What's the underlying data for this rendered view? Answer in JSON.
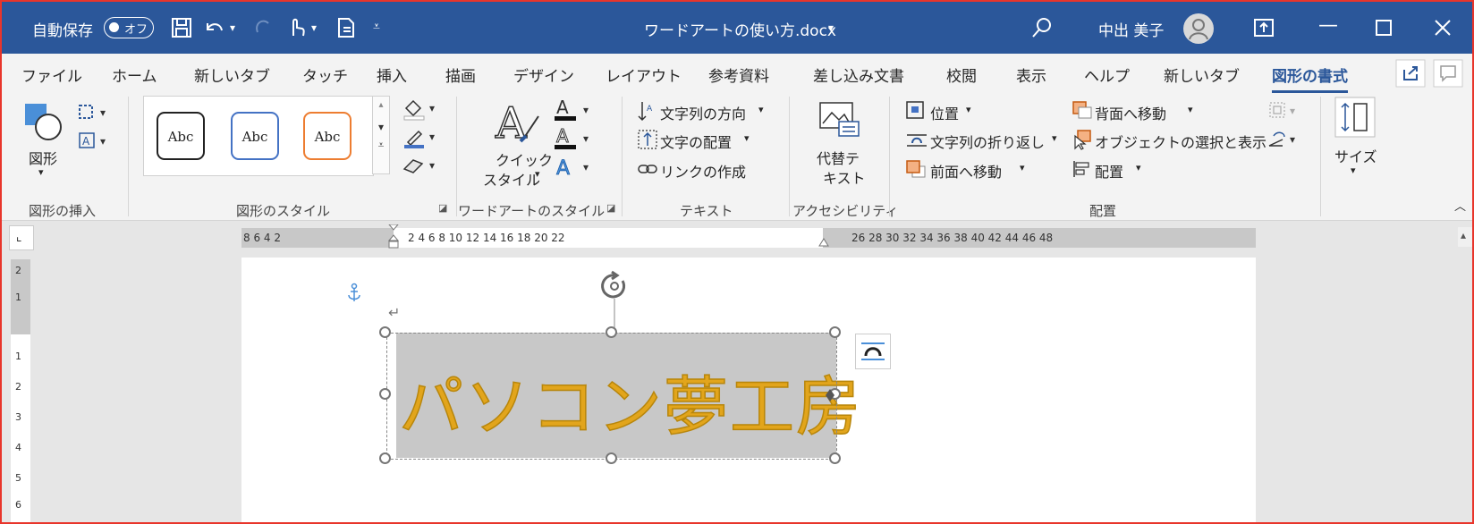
{
  "titlebar": {
    "autosave_label": "自動保存",
    "autosave_toggle": "オフ",
    "doc_title": "ワードアートの使い方.docx",
    "user_name": "中出 美子",
    "colors": {
      "bar": "#2b579a"
    }
  },
  "tabs": [
    "ファイル",
    "ホーム",
    "新しいタブ",
    "タッチ",
    "挿入",
    "描画",
    "デザイン",
    "レイアウト",
    "参考資料",
    "差し込み文書",
    "校閲",
    "表示",
    "ヘルプ",
    "新しいタブ",
    "図形の書式"
  ],
  "active_tab": "図形の書式",
  "ribbon": {
    "insert_shapes": {
      "shape_label": "図形",
      "group": "図形の挿入"
    },
    "shape_styles": {
      "samples": [
        "Abc",
        "Abc",
        "Abc"
      ],
      "group": "図形のスタイル"
    },
    "wordart_styles": {
      "quick_line1": "クイック",
      "quick_line2": "スタイル",
      "group": "ワードアートのスタイル"
    },
    "text": {
      "direction": "文字列の方向",
      "align": "文字の配置",
      "link": "リンクの作成",
      "group": "テキスト"
    },
    "accessibility": {
      "alt1": "代替テ",
      "alt2": "キスト",
      "group": "アクセシビリティ"
    },
    "arrange": {
      "position": "位置",
      "wrap": "文字列の折り返し",
      "forward": "前面へ移動",
      "backward": "背面へ移動",
      "selection": "オブジェクトの選択と表示",
      "align": "配置",
      "group": "配置"
    },
    "size": {
      "label": "サイズ"
    }
  },
  "ruler": {
    "h_left": "8 6 4 2",
    "h_mid": "2 4 6 8 10 12 14 16 18 20 22",
    "h_right": "26 28 30 32 34 36 38 40 42 44 46 48",
    "v_marks": [
      "2",
      "1",
      "1",
      "1",
      "2",
      "3",
      "4",
      "5",
      "6"
    ]
  },
  "document": {
    "wordart_text": "パソコン夢工房",
    "paragraph_mark": "↵",
    "wordart_color": "#e2a51c"
  }
}
